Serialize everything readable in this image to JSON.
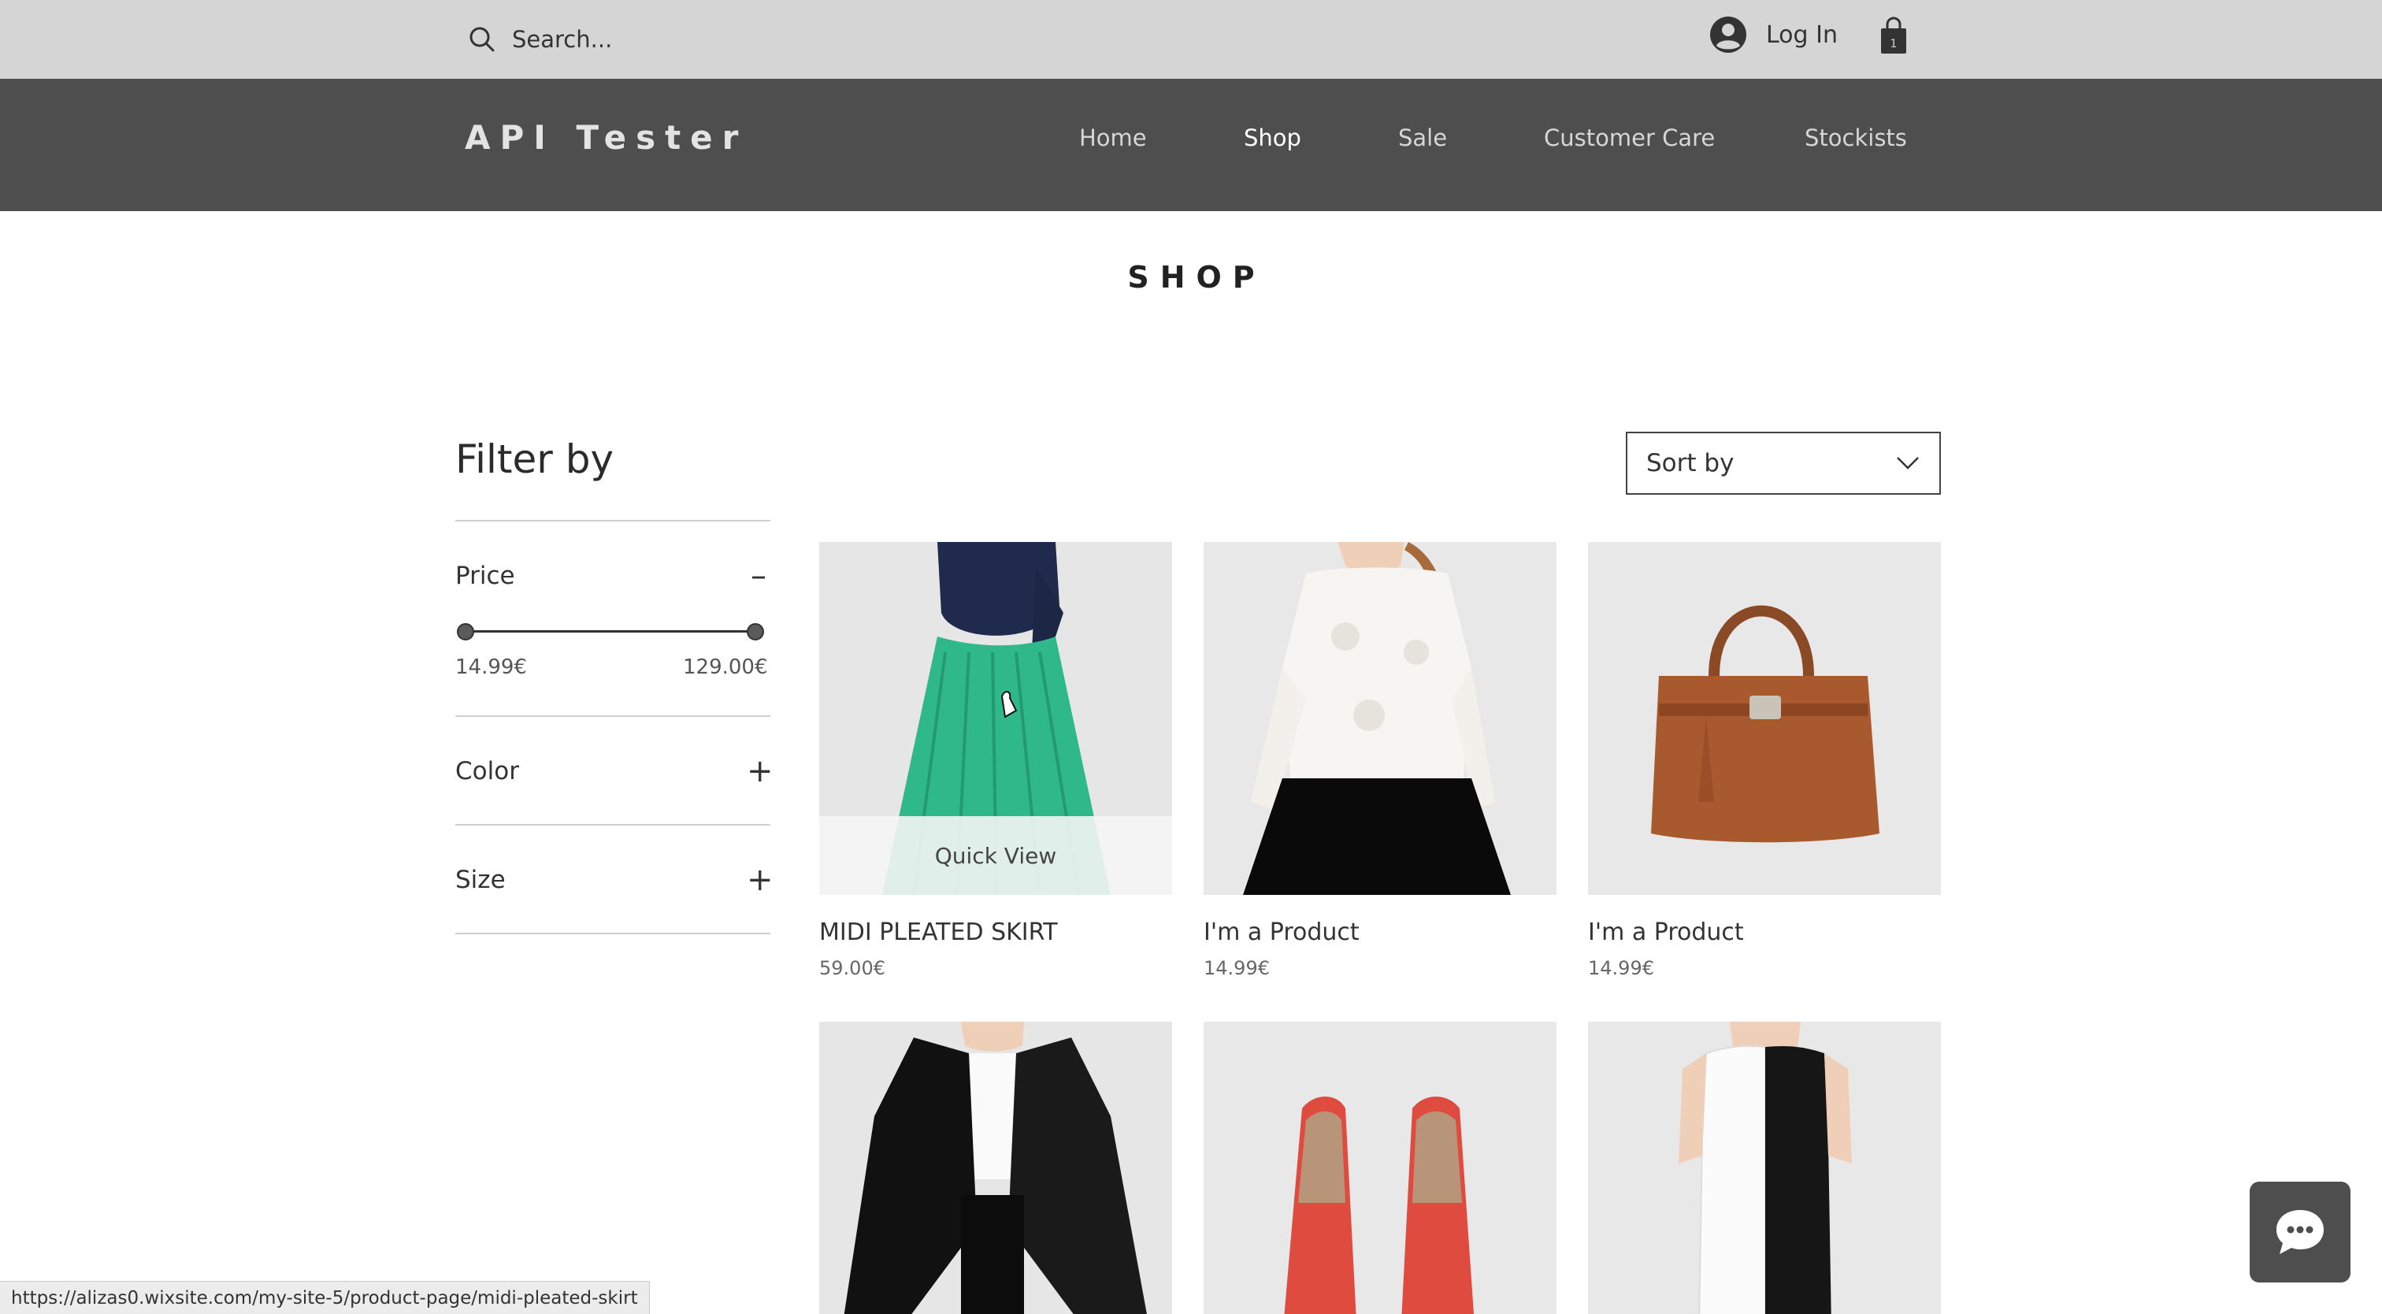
{
  "topbar": {
    "search_placeholder": "Search...",
    "login_label": "Log In",
    "cart_count": "1",
    "icons": {
      "search": "search-icon",
      "account": "account-icon",
      "cart": "shopping-bag-icon"
    }
  },
  "header": {
    "logo": "API Tester",
    "nav": [
      {
        "label": "Home",
        "active": false
      },
      {
        "label": "Shop",
        "active": true
      },
      {
        "label": "Sale",
        "active": false
      },
      {
        "label": "Customer Care",
        "active": false
      },
      {
        "label": "Stockists",
        "active": false
      }
    ]
  },
  "page": {
    "title": "SHOP"
  },
  "filter": {
    "title": "Filter by",
    "sections": [
      {
        "label": "Price",
        "expanded": true,
        "toggle": "–"
      },
      {
        "label": "Color",
        "expanded": false,
        "toggle": "+"
      },
      {
        "label": "Size",
        "expanded": false,
        "toggle": "+"
      }
    ],
    "price": {
      "min": "14.99€",
      "max": "129.00€"
    }
  },
  "sort": {
    "label": "Sort by"
  },
  "products": [
    {
      "name": "MIDI PLEATED SKIRT",
      "price": "59.00€",
      "image": "green-pleated-skirt",
      "quick_view": "Quick View"
    },
    {
      "name": "I'm a Product",
      "price": "14.99€",
      "image": "white-lace-blouse"
    },
    {
      "name": "I'm a Product",
      "price": "14.99€",
      "image": "brown-leather-handbag"
    },
    {
      "name": "",
      "price": "",
      "image": "black-coat"
    },
    {
      "name": "",
      "price": "",
      "image": "red-loafers"
    },
    {
      "name": "",
      "price": "",
      "image": "black-white-dress"
    }
  ],
  "status_bar": {
    "url": "https://alizas0.wixsite.com/my-site-5/product-page/midi-pleated-skirt"
  },
  "colors": {
    "topbar": "#d5d5d5",
    "header": "#4e4e4f",
    "chat": "#4e4e4f"
  }
}
